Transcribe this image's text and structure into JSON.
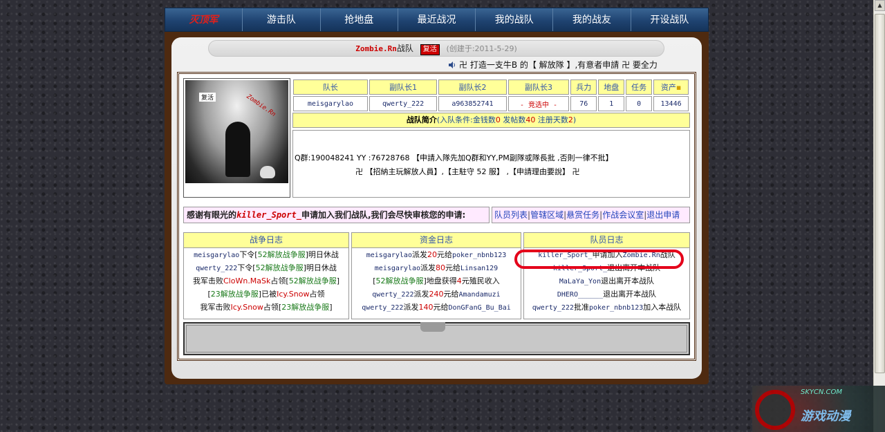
{
  "nav": {
    "brand": "灭顶军",
    "items": [
      "游击队",
      "抢地盘",
      "最近战况",
      "我的战队",
      "我的战友",
      "开设战队"
    ]
  },
  "title": {
    "team_name": "Zombie.Rn",
    "team_suffix": "战队",
    "status_badge": "复活",
    "created": "(创建于:2011-5-29)"
  },
  "marquee": "卍 打造一支牛B 的【 解放隊 】,有意者申請 卍 要全力",
  "avatar": {
    "label": "复活",
    "logo": "Zombie.Rn"
  },
  "info": {
    "headers": [
      "队长",
      "副队长1",
      "副队长2",
      "副队长3",
      "兵力",
      "地盘",
      "任务",
      "资产"
    ],
    "values": [
      "meisgarylao",
      "qwerty_222",
      "a963852741",
      "- 竞选中 -",
      "76",
      "1",
      "0",
      "13446"
    ]
  },
  "intro": {
    "title": "战队简介",
    "cond_prefix": "(入队条件:金钱数",
    "money": "0",
    "posts_label": " 发帖数",
    "posts": "40",
    "days_label": " 注册天数",
    "days": "2",
    "cond_suffix": ")",
    "line1": "Q群:190048241 YY :76728768 【申請入隊先加Q群和YY,PM副隊或隊長批 ,否則一律不批】",
    "line2": "卍 【招納主玩解放人員】,【主駐守 52 服】 ,【申請理由要說】 卍"
  },
  "notice": {
    "prefix": "感谢有眼光的",
    "user": "killer_Sport_",
    "suffix": "申请加入我们战队,我们会尽快审核您的申请:"
  },
  "links": [
    "队员列表",
    "管辖区域",
    "悬赏任务",
    "作战会议室",
    "退出申请"
  ],
  "logs": {
    "war": {
      "title": "战争日志",
      "lines": [
        [
          {
            "c": "u",
            "t": "meisgarylao"
          },
          {
            "c": "t",
            "t": "下令["
          },
          {
            "c": "g",
            "t": "52解放战争服"
          },
          {
            "c": "t",
            "t": "]明日休战"
          }
        ],
        [
          {
            "c": "u",
            "t": "qwerty_222"
          },
          {
            "c": "t",
            "t": "下令["
          },
          {
            "c": "g",
            "t": "52解放战争服"
          },
          {
            "c": "t",
            "t": "]明日休战"
          }
        ],
        [
          {
            "c": "t",
            "t": "我军击败"
          },
          {
            "c": "r",
            "t": "CloWn.MaSk"
          },
          {
            "c": "t",
            "t": "占领["
          },
          {
            "c": "g",
            "t": "52解放战争服"
          },
          {
            "c": "t",
            "t": "]"
          }
        ],
        [
          {
            "c": "t",
            "t": "["
          },
          {
            "c": "g",
            "t": "23解放战争服"
          },
          {
            "c": "t",
            "t": "]已被"
          },
          {
            "c": "r",
            "t": "Icy.Snow"
          },
          {
            "c": "t",
            "t": "占领"
          }
        ],
        [
          {
            "c": "t",
            "t": "我军击败"
          },
          {
            "c": "r",
            "t": "Icy.Snow"
          },
          {
            "c": "t",
            "t": "占领["
          },
          {
            "c": "g",
            "t": "23解放战争服"
          },
          {
            "c": "t",
            "t": "]"
          }
        ]
      ]
    },
    "fund": {
      "title": "资金日志",
      "lines": [
        [
          {
            "c": "u",
            "t": "meisgarylao"
          },
          {
            "c": "t",
            "t": "派发"
          },
          {
            "c": "r",
            "t": "20"
          },
          {
            "c": "t",
            "t": "元给"
          },
          {
            "c": "u",
            "t": "poker_nbnb123"
          }
        ],
        [
          {
            "c": "u",
            "t": "meisgarylao"
          },
          {
            "c": "t",
            "t": "派发"
          },
          {
            "c": "r",
            "t": "80"
          },
          {
            "c": "t",
            "t": "元给"
          },
          {
            "c": "u",
            "t": "Linsan129"
          }
        ],
        [
          {
            "c": "t",
            "t": "["
          },
          {
            "c": "g",
            "t": "52解放战争服"
          },
          {
            "c": "t",
            "t": "]地盘获得"
          },
          {
            "c": "r",
            "t": "4"
          },
          {
            "c": "t",
            "t": "元殖民收入"
          }
        ],
        [
          {
            "c": "u",
            "t": "qwerty_222"
          },
          {
            "c": "t",
            "t": "派发"
          },
          {
            "c": "r",
            "t": "240"
          },
          {
            "c": "t",
            "t": "元给"
          },
          {
            "c": "u",
            "t": "Amandamuzi"
          }
        ],
        [
          {
            "c": "u",
            "t": "qwerty_222"
          },
          {
            "c": "t",
            "t": "派发"
          },
          {
            "c": "r",
            "t": "140"
          },
          {
            "c": "t",
            "t": "元给"
          },
          {
            "c": "u",
            "t": "DonGFanG_Bu_Bai"
          }
        ]
      ]
    },
    "member": {
      "title": "队员日志",
      "lines": [
        [
          {
            "c": "u",
            "t": "killer_Sport_"
          },
          {
            "c": "t",
            "t": "申请加入"
          },
          {
            "c": "u",
            "t": "Zombie.Rn"
          },
          {
            "c": "t",
            "t": "战队"
          }
        ],
        [
          {
            "c": "u",
            "t": "killer_Sport_"
          },
          {
            "c": "t",
            "t": "退出离开本战队"
          }
        ],
        [
          {
            "c": "u",
            "t": "MaLaYa_Yon"
          },
          {
            "c": "t",
            "t": "退出离开本战队"
          }
        ],
        [
          {
            "c": "u",
            "t": "DHERO______"
          },
          {
            "c": "t",
            "t": "退出离开本战队"
          }
        ],
        [
          {
            "c": "u",
            "t": "qwerty_222"
          },
          {
            "c": "t",
            "t": "批准"
          },
          {
            "c": "u",
            "t": "poker_nbnb123"
          },
          {
            "c": "t",
            "t": "加入本战队"
          }
        ]
      ]
    }
  },
  "watermark": {
    "top": "SKYCN.COM",
    "bottom": "游戏动漫"
  },
  "colors": {
    "nav": "#1f4371",
    "frame": "#4e2a10",
    "header_cell": "#ffff99",
    "highlight": "#e4001a"
  }
}
